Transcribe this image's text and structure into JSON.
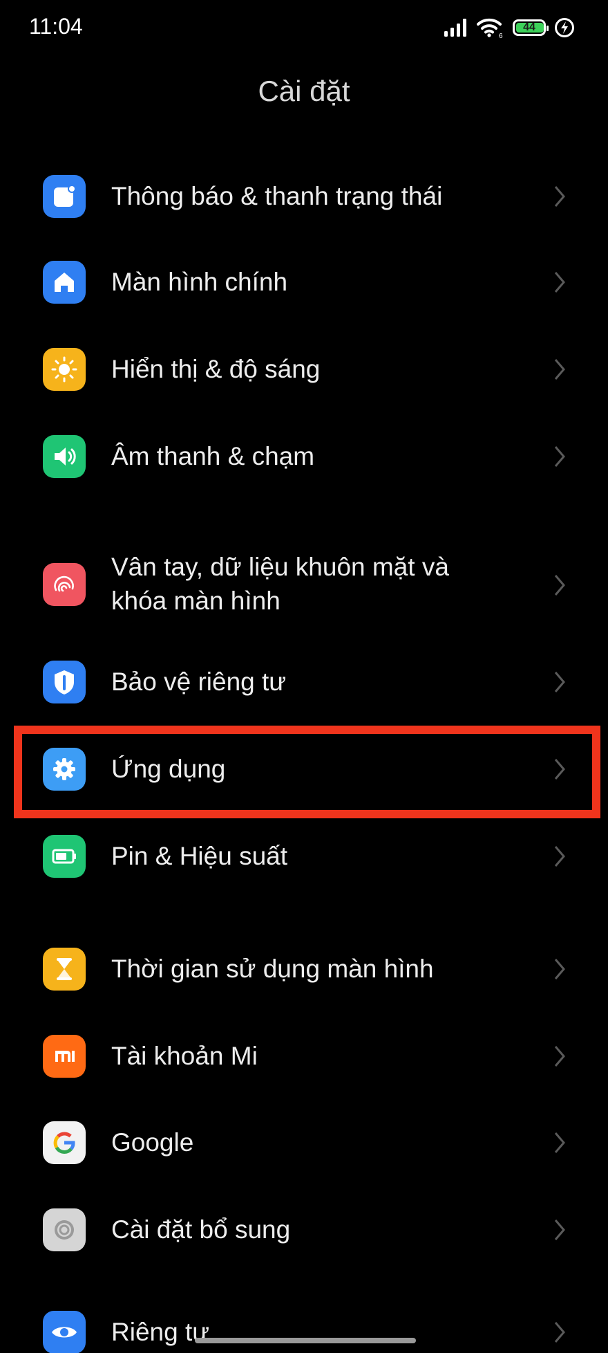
{
  "status_bar": {
    "time": "11:04",
    "signal_icon": "signal-bars-icon",
    "wifi_icon": "wifi-6-icon",
    "wifi_badge": "6",
    "battery_level": "44",
    "battery_fill_fraction": 0.44,
    "charging_icon": "charging-bolt-icon"
  },
  "header": {
    "title": "Cài đặt"
  },
  "colors": {
    "background": "#000000",
    "highlight_border": "#f0341c",
    "notifications": "#2f7ff2",
    "home_screen": "#2f7ff2",
    "display": "#f6b31b",
    "sound": "#1fc574",
    "fingerprint": "#f05560",
    "privacy_protection": "#2f7ff2",
    "apps": "#3d9df5",
    "battery": "#1fc574",
    "screen_time": "#f6b31b",
    "mi_account": "#ff6a14",
    "google": "#f2f2f2",
    "additional_settings": "#d5d5d5",
    "privacy": "#2f7ff2"
  },
  "settings": {
    "items": [
      {
        "label": "Thông báo & thanh trạng thái",
        "icon": "notification-icon"
      },
      {
        "label": "Màn hình chính",
        "icon": "home-icon"
      },
      {
        "label": "Hiển thị & độ sáng",
        "icon": "brightness-sun-icon"
      },
      {
        "label": "Âm thanh & chạm",
        "icon": "speaker-icon"
      },
      {
        "label_line1": "Vân tay, dữ liệu khuôn mặt và",
        "label_line2": "khóa màn hình",
        "icon": "fingerprint-icon"
      },
      {
        "label": "Bảo vệ riêng tư",
        "icon": "privacy-shield-icon"
      },
      {
        "label": "Ứng dụng",
        "icon": "gear-icon",
        "highlighted": true
      },
      {
        "label": "Pin & Hiệu suất",
        "icon": "battery-icon"
      },
      {
        "label": "Thời gian sử dụng màn hình",
        "icon": "hourglass-icon"
      },
      {
        "label": "Tài khoản Mi",
        "icon": "mi-logo-icon"
      },
      {
        "label": "Google",
        "icon": "google-logo-icon"
      },
      {
        "label": "Cài đặt bổ sung",
        "icon": "gear-outline-icon"
      },
      {
        "label": "Riêng tư",
        "icon": "eye-icon"
      }
    ]
  }
}
